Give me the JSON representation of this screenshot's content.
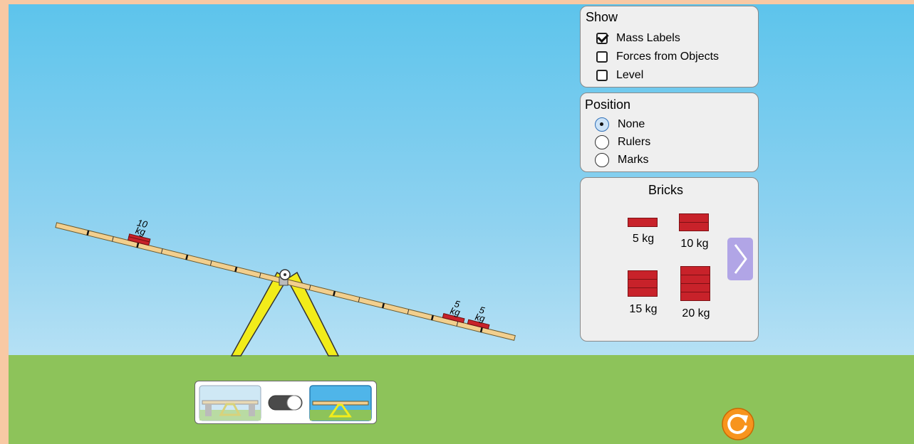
{
  "show_panel": {
    "title": "Show",
    "options": [
      {
        "label": "Mass Labels",
        "checked": true
      },
      {
        "label": "Forces from Objects",
        "checked": false
      },
      {
        "label": "Level",
        "checked": false
      }
    ]
  },
  "position_panel": {
    "title": "Position",
    "options": [
      {
        "label": "None",
        "selected": true
      },
      {
        "label": "Rulers",
        "selected": false
      },
      {
        "label": "Marks",
        "selected": false
      }
    ]
  },
  "bricks_panel": {
    "title": "Bricks",
    "items": [
      {
        "label": "5 kg",
        "count": 1
      },
      {
        "label": "10 kg",
        "count": 2
      },
      {
        "label": "15 kg",
        "count": 3
      },
      {
        "label": "20 kg",
        "count": 4
      }
    ],
    "next_icon": "chevron-right-icon"
  },
  "plank_bricks": {
    "left": {
      "mass": "10",
      "unit": "kg"
    },
    "right1": {
      "mass": "5",
      "unit": "kg"
    },
    "right2": {
      "mass": "5",
      "unit": "kg"
    }
  },
  "toggle": {
    "state": "right",
    "left_icon": "supports-icon",
    "right_icon": "no-supports-icon"
  },
  "reset": {
    "icon": "reset-icon"
  },
  "colors": {
    "sky_top": "#5dc4ec",
    "grass": "#8dc35a",
    "brick": "#c8222a",
    "fulcrum": "#f2ec1a",
    "plank": "#f2cf8e",
    "accent": "#f7941d"
  }
}
